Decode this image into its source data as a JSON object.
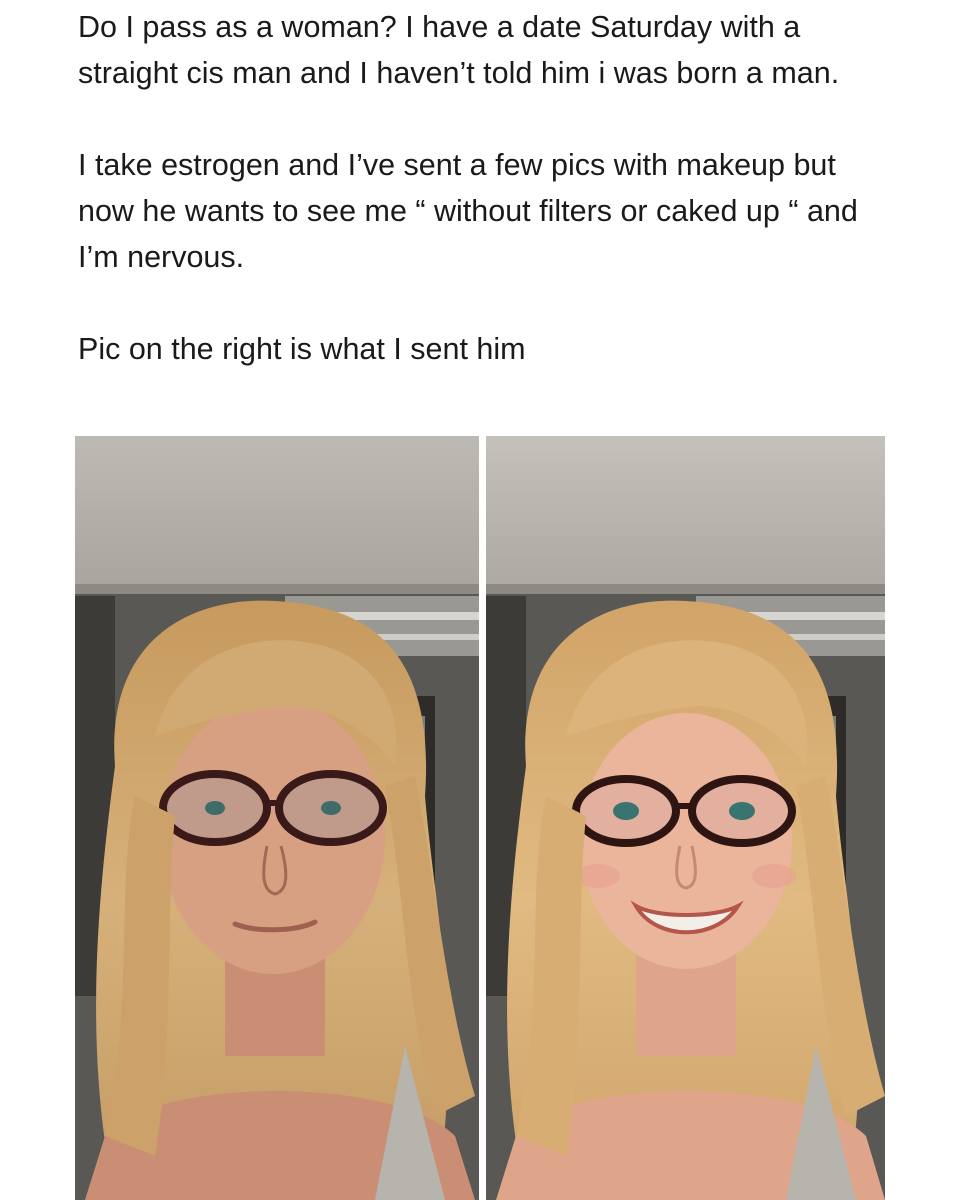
{
  "post": {
    "paragraphs": [
      "Do I pass as a woman? I have a date Saturday with a straight cis man and I haven’t told him i was born a man.",
      "I take estrogen and I’ve sent a few pics with makeup but now he wants to see me “ without filters or caked up “ and I’m nervous.",
      "Pic on the right is what I sent him"
    ]
  },
  "photos": [
    {
      "name": "photo-unfiltered",
      "expression": "neutral"
    },
    {
      "name": "photo-filtered",
      "expression": "smiling"
    }
  ],
  "colors": {
    "background": "#ffffff",
    "text": "#1a1a1a",
    "hair": "#cfa468",
    "skin": "#d9a283",
    "ceiling": "#c9c6bf",
    "van_interior": "#4b4b4b"
  }
}
